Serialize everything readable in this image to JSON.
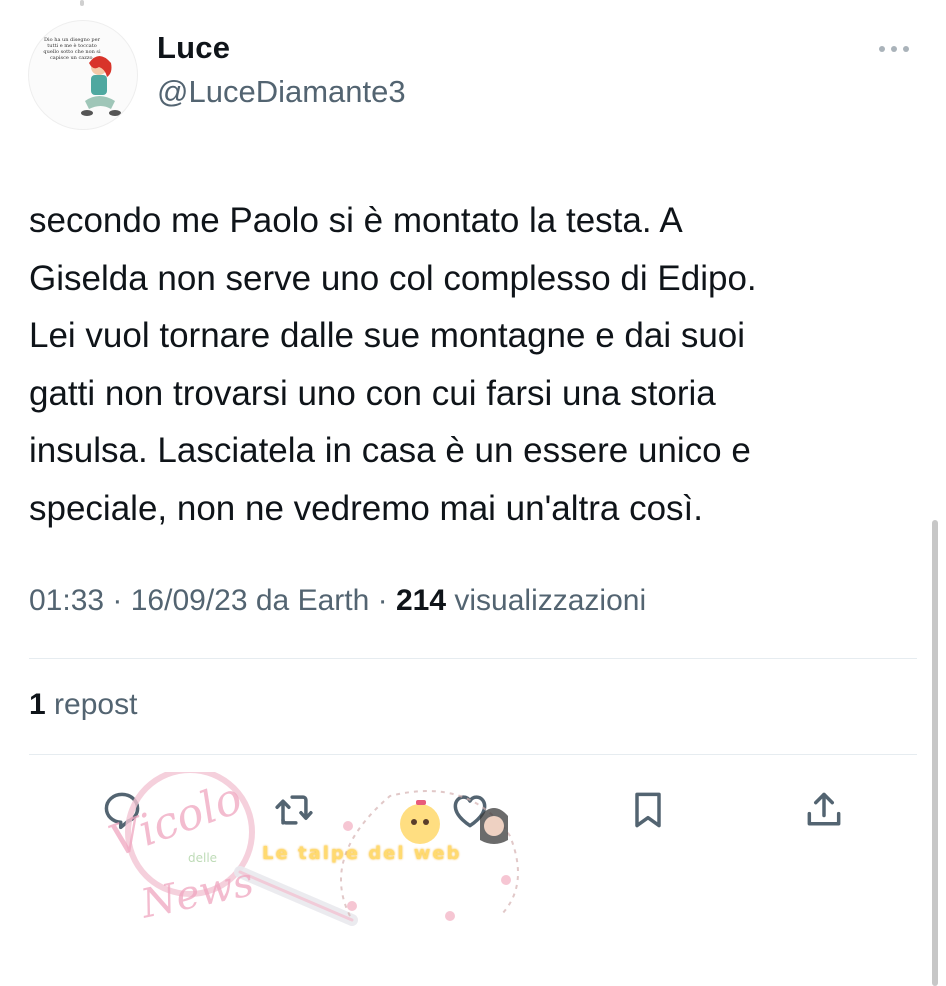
{
  "user": {
    "display_name": "Luce",
    "handle": "@LuceDiamante3",
    "avatar_text": "Dio ha un disegno per tutti e me è toccato quello sotto che non si capisce un cazzo."
  },
  "tweet": {
    "text": "secondo me Paolo si è montato la testa. A\nGiselda non serve uno col complesso di Edipo.\nLei vuol tornare dalle sue montagne e dai suoi\ngatti non trovarsi uno con cui farsi una storia\ninsulsa. Lasciatela in casa è un essere unico e\nspeciale, non ne vedremo mai un'altra così.",
    "time": "01:33",
    "date": "16/09/23",
    "source": "da Earth",
    "views_count": "214",
    "views_label": "visualizzazioni"
  },
  "stats": {
    "repost_count": "1",
    "repost_label": "repost"
  },
  "actions": [
    "reply-icon",
    "repost-icon",
    "like-icon",
    "bookmark-icon",
    "share-icon"
  ],
  "watermarks": {
    "left": "Vicolo delle News",
    "right": "Le talpe del web"
  },
  "colors": {
    "text": "#0f1419",
    "secondary": "#536471",
    "divider": "#e6ecf0"
  }
}
